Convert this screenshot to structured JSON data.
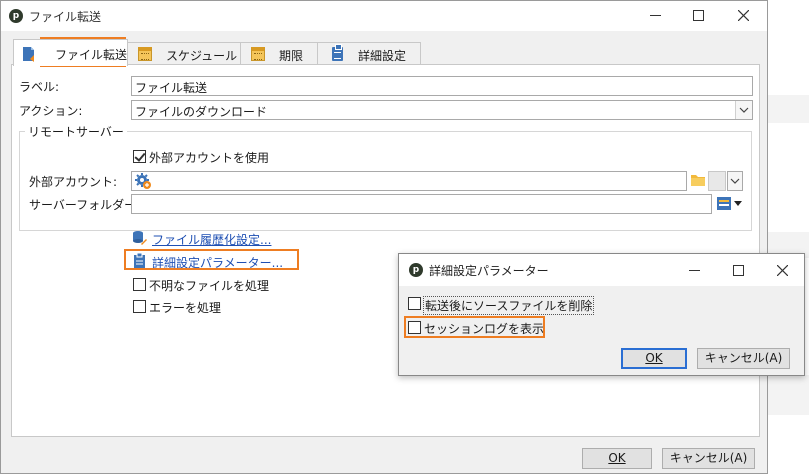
{
  "window": {
    "title": "ファイル転送",
    "controls": {
      "minimize": "minimize-icon",
      "maximize": "maximize-icon",
      "close": "close-icon"
    }
  },
  "tabs": [
    {
      "label": "ファイル転送",
      "icon": "file-transfer-icon",
      "selected": true
    },
    {
      "label": "スケジュール",
      "icon": "calendar-icon"
    },
    {
      "label": "期限",
      "icon": "calendar-icon"
    },
    {
      "label": "詳細設定",
      "icon": "clipboard-icon"
    }
  ],
  "form": {
    "label_field": {
      "label": "ラベル:",
      "value": "ファイル転送"
    },
    "action_field": {
      "label": "アクション:",
      "value": "ファイルのダウンロード"
    },
    "remote_server": {
      "group_title": "リモートサーバー",
      "use_external_account": {
        "label": "外部アカウントを使用",
        "checked": true
      },
      "external_account": {
        "label": "外部アカウント:",
        "value": ""
      },
      "server_folder": {
        "label": "サーバーフォルダー:",
        "value": ""
      }
    },
    "links": {
      "history": "ファイル履歴化設定...",
      "advanced_params": "詳細設定パラメーター..."
    },
    "process_unknown": {
      "label": "不明なファイルを処理",
      "checked": false
    },
    "process_errors": {
      "label": "エラーを処理",
      "checked": false
    }
  },
  "footer": {
    "ok_label": "OK",
    "cancel_label": "キャンセル(A)"
  },
  "dialog": {
    "title": "詳細設定パラメーター",
    "delete_source": {
      "label": "転送後にソースファイルを削除",
      "checked": false
    },
    "show_session_log": {
      "label": "セッションログを表示",
      "checked": false
    },
    "ok_label": "OK",
    "cancel_label": "キャンセル(A)"
  },
  "colors": {
    "highlight": "#ee7d22",
    "link": "#1e4fb3",
    "default_button_border": "#2a6ed3"
  }
}
